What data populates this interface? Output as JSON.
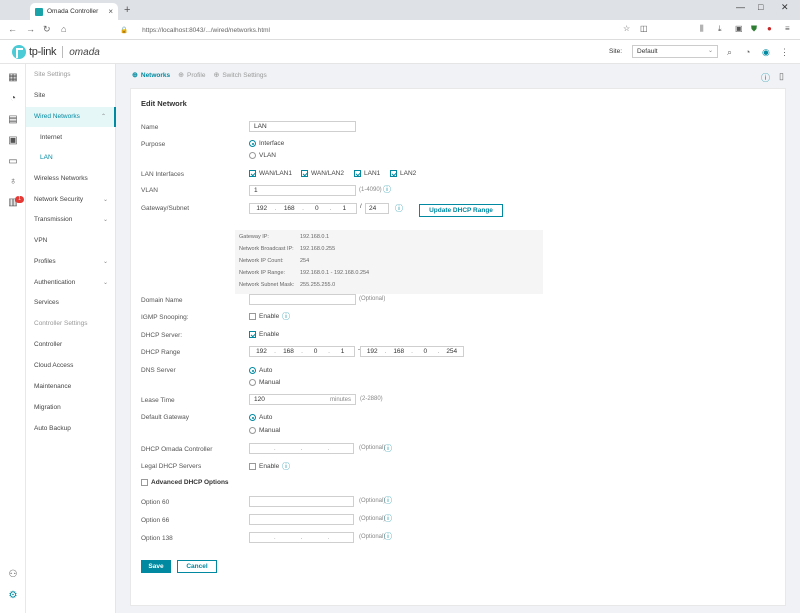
{
  "browser": {
    "tab_title": "Omada Controller",
    "url": "https://localhost:8043/.../wired/networks.html",
    "new_tab": "+",
    "window_controls": {
      "minimize": "—",
      "maximize": "□",
      "close": "✕"
    }
  },
  "header": {
    "brand": "tp-link",
    "product": "omada",
    "site_label": "Site:",
    "site_value": "Default"
  },
  "menu": {
    "site_settings_title": "Site Settings",
    "site": "Site",
    "wired_networks": "Wired Networks",
    "internet": "Internet",
    "lan": "LAN",
    "wireless_networks": "Wireless Networks",
    "network_security": "Network Security",
    "transmission": "Transmission",
    "vpn": "VPN",
    "profiles": "Profiles",
    "authentication": "Authentication",
    "services": "Services",
    "controller_settings_title": "Controller Settings",
    "controller": "Controller",
    "cloud_access": "Cloud Access",
    "maintenance": "Maintenance",
    "migration": "Migration",
    "auto_backup": "Auto Backup"
  },
  "rail": {
    "alert_badge": "1"
  },
  "tabs": {
    "networks": "Networks",
    "profile": "Profile",
    "switch_settings": "Switch Settings"
  },
  "form": {
    "title": "Edit Network",
    "name_label": "Name",
    "name_value": "LAN",
    "purpose_label": "Purpose",
    "purpose_interface": "Interface",
    "purpose_vlan": "VLAN",
    "lan_interfaces_label": "LAN Interfaces",
    "lan_interfaces": [
      "WAN/LAN1",
      "WAN/LAN2",
      "LAN1",
      "LAN2"
    ],
    "vlan_label": "VLAN",
    "vlan_value": "1",
    "vlan_range": "(1-4090)",
    "gateway_label": "Gateway/Subnet",
    "gateway_ip": [
      "192",
      "168",
      "0",
      "1"
    ],
    "gateway_mask": "24",
    "update_dhcp_btn": "Update DHCP Range",
    "summary": {
      "gateway_ip_label": "Gateway IP:",
      "gateway_ip_value": "192.168.0.1",
      "broadcast_label": "Network Broadcast IP:",
      "broadcast_value": "192.168.0.255",
      "ip_count_label": "Network IP Count:",
      "ip_count_value": "254",
      "ip_range_label": "Network IP Range:",
      "ip_range_value": "192.168.0.1 - 192.168.0.254",
      "mask_label": "Network Subnet Mask:",
      "mask_value": "255.255.255.0"
    },
    "domain_label": "Domain Name",
    "optional": "(Optional)",
    "igmp_label": "IGMP Snooping:",
    "enable": "Enable",
    "dhcp_server_label": "DHCP Server:",
    "dhcp_range_label": "DHCP Range",
    "dhcp_start": [
      "192",
      "168",
      "0",
      "1"
    ],
    "dhcp_end": [
      "192",
      "168",
      "0",
      "254"
    ],
    "dns_label": "DNS Server",
    "auto": "Auto",
    "manual": "Manual",
    "lease_label": "Lease Time",
    "lease_value": "120",
    "lease_unit": "minutes",
    "lease_range": "(2-2880)",
    "default_gw_label": "Default Gateway",
    "dhcp_omada_label": "DHCP Omada Controller",
    "legal_dhcp_label": "Legal DHCP Servers",
    "advanced_label": "Advanced DHCP Options",
    "option60_label": "Option 60",
    "option66_label": "Option 66",
    "option138_label": "Option 138",
    "save": "Save",
    "cancel": "Cancel"
  }
}
